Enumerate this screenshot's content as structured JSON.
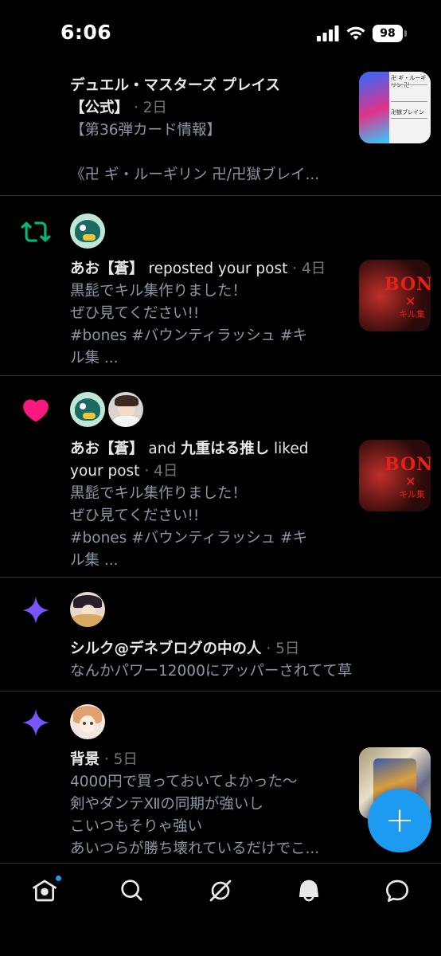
{
  "status_bar": {
    "time": "6:06",
    "battery": "98"
  },
  "notifications": [
    {
      "type": "post",
      "author": "デュエル・マスターズ プレイス【公式】",
      "author_line1": "デュエル・マスターズ プレイス",
      "author_line2": "【公式】",
      "time": " · 2日",
      "preview_lines": [
        "【第36弾カード情報】",
        "",
        "《卍 ギ・ルーギリン 卍/卍獄ブレイ..."
      ],
      "thumb_card_title": "卍 ギ・ルーギリン 卍",
      "thumb_card_sub": "卍獄ブレイン"
    },
    {
      "type": "repost",
      "icon": "repost-icon",
      "actor": "あお【蒼】",
      "action": " reposted your post",
      "time": " · 4日",
      "preview_lines": [
        "黒髭でキル集作りました！",
        "ぜひ見てください!!",
        " #bones  #バウンティラッシュ  #キ",
        "ル集 ..."
      ],
      "thumb_title": "BONES",
      "thumb_x": "×",
      "thumb_sub": "キル集"
    },
    {
      "type": "like",
      "icon": "heart-icon",
      "actor1": "あお【蒼】",
      "joiner": " and ",
      "actor2": "九重はる推し",
      "action": " liked",
      "action2": "your post",
      "time": " · 4日",
      "preview_lines": [
        "黒髭でキル集作りました！",
        "ぜひ見てください!!",
        " #bones  #バウンティラッシュ  #キ",
        "ル集 ..."
      ],
      "thumb_title": "BONES",
      "thumb_x": "×",
      "thumb_sub": "キル集"
    },
    {
      "type": "recommendation",
      "icon": "sparkle-icon",
      "author": "シルク@デネブログの中の人",
      "time": " · 5日",
      "preview_lines": [
        "なんかパワー12000にアッパーされてて草"
      ]
    },
    {
      "type": "recommendation",
      "icon": "sparkle-icon",
      "author": "背景",
      "time": " · 5日",
      "preview_lines": [
        "4000円で買っておいてよかった〜",
        "剣やダンテⅫの同期が強いし",
        "こいつもそりゃ強い",
        "あいつらが勝ち壊れているだけでこ..."
      ]
    }
  ],
  "fab": {
    "label": "+"
  },
  "tab_bar": {
    "tabs": [
      "home-icon",
      "search-icon",
      "grok-icon",
      "notifications-icon",
      "messages-icon"
    ],
    "home_badge_color": "#1d9bf0"
  },
  "colors": {
    "repost": "#00ba7c",
    "like": "#f91880",
    "sparkle": "#7856ff",
    "accent": "#1d9bf0"
  }
}
